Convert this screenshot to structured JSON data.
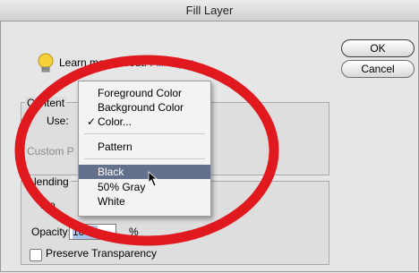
{
  "window": {
    "title": "Fill Layer"
  },
  "buttons": {
    "ok": "OK",
    "cancel": "Cancel"
  },
  "help": {
    "prefix": "Learn more about:",
    "link": "Fill Layer"
  },
  "contents_group": {
    "label": "Content",
    "use_label": "Use:",
    "custom_label": "Custom P"
  },
  "blending_group": {
    "label": "lending",
    "mode_label": "Mo",
    "opacity_label": "Opacity:",
    "opacity_value": "100",
    "opacity_unit": "%"
  },
  "preserve_transparency": {
    "label": "Preserve Transparency",
    "checked": false
  },
  "dropdown": {
    "items": [
      {
        "label": "Foreground Color"
      },
      {
        "label": "Background Color"
      },
      {
        "label": "Color...",
        "checked": true
      },
      {
        "label": "Pattern"
      },
      {
        "label": "Black",
        "selected": true
      },
      {
        "label": "50% Gray"
      },
      {
        "label": "White"
      }
    ]
  },
  "annotation_color": "#e0191f",
  "highlight_color": "#63708c"
}
